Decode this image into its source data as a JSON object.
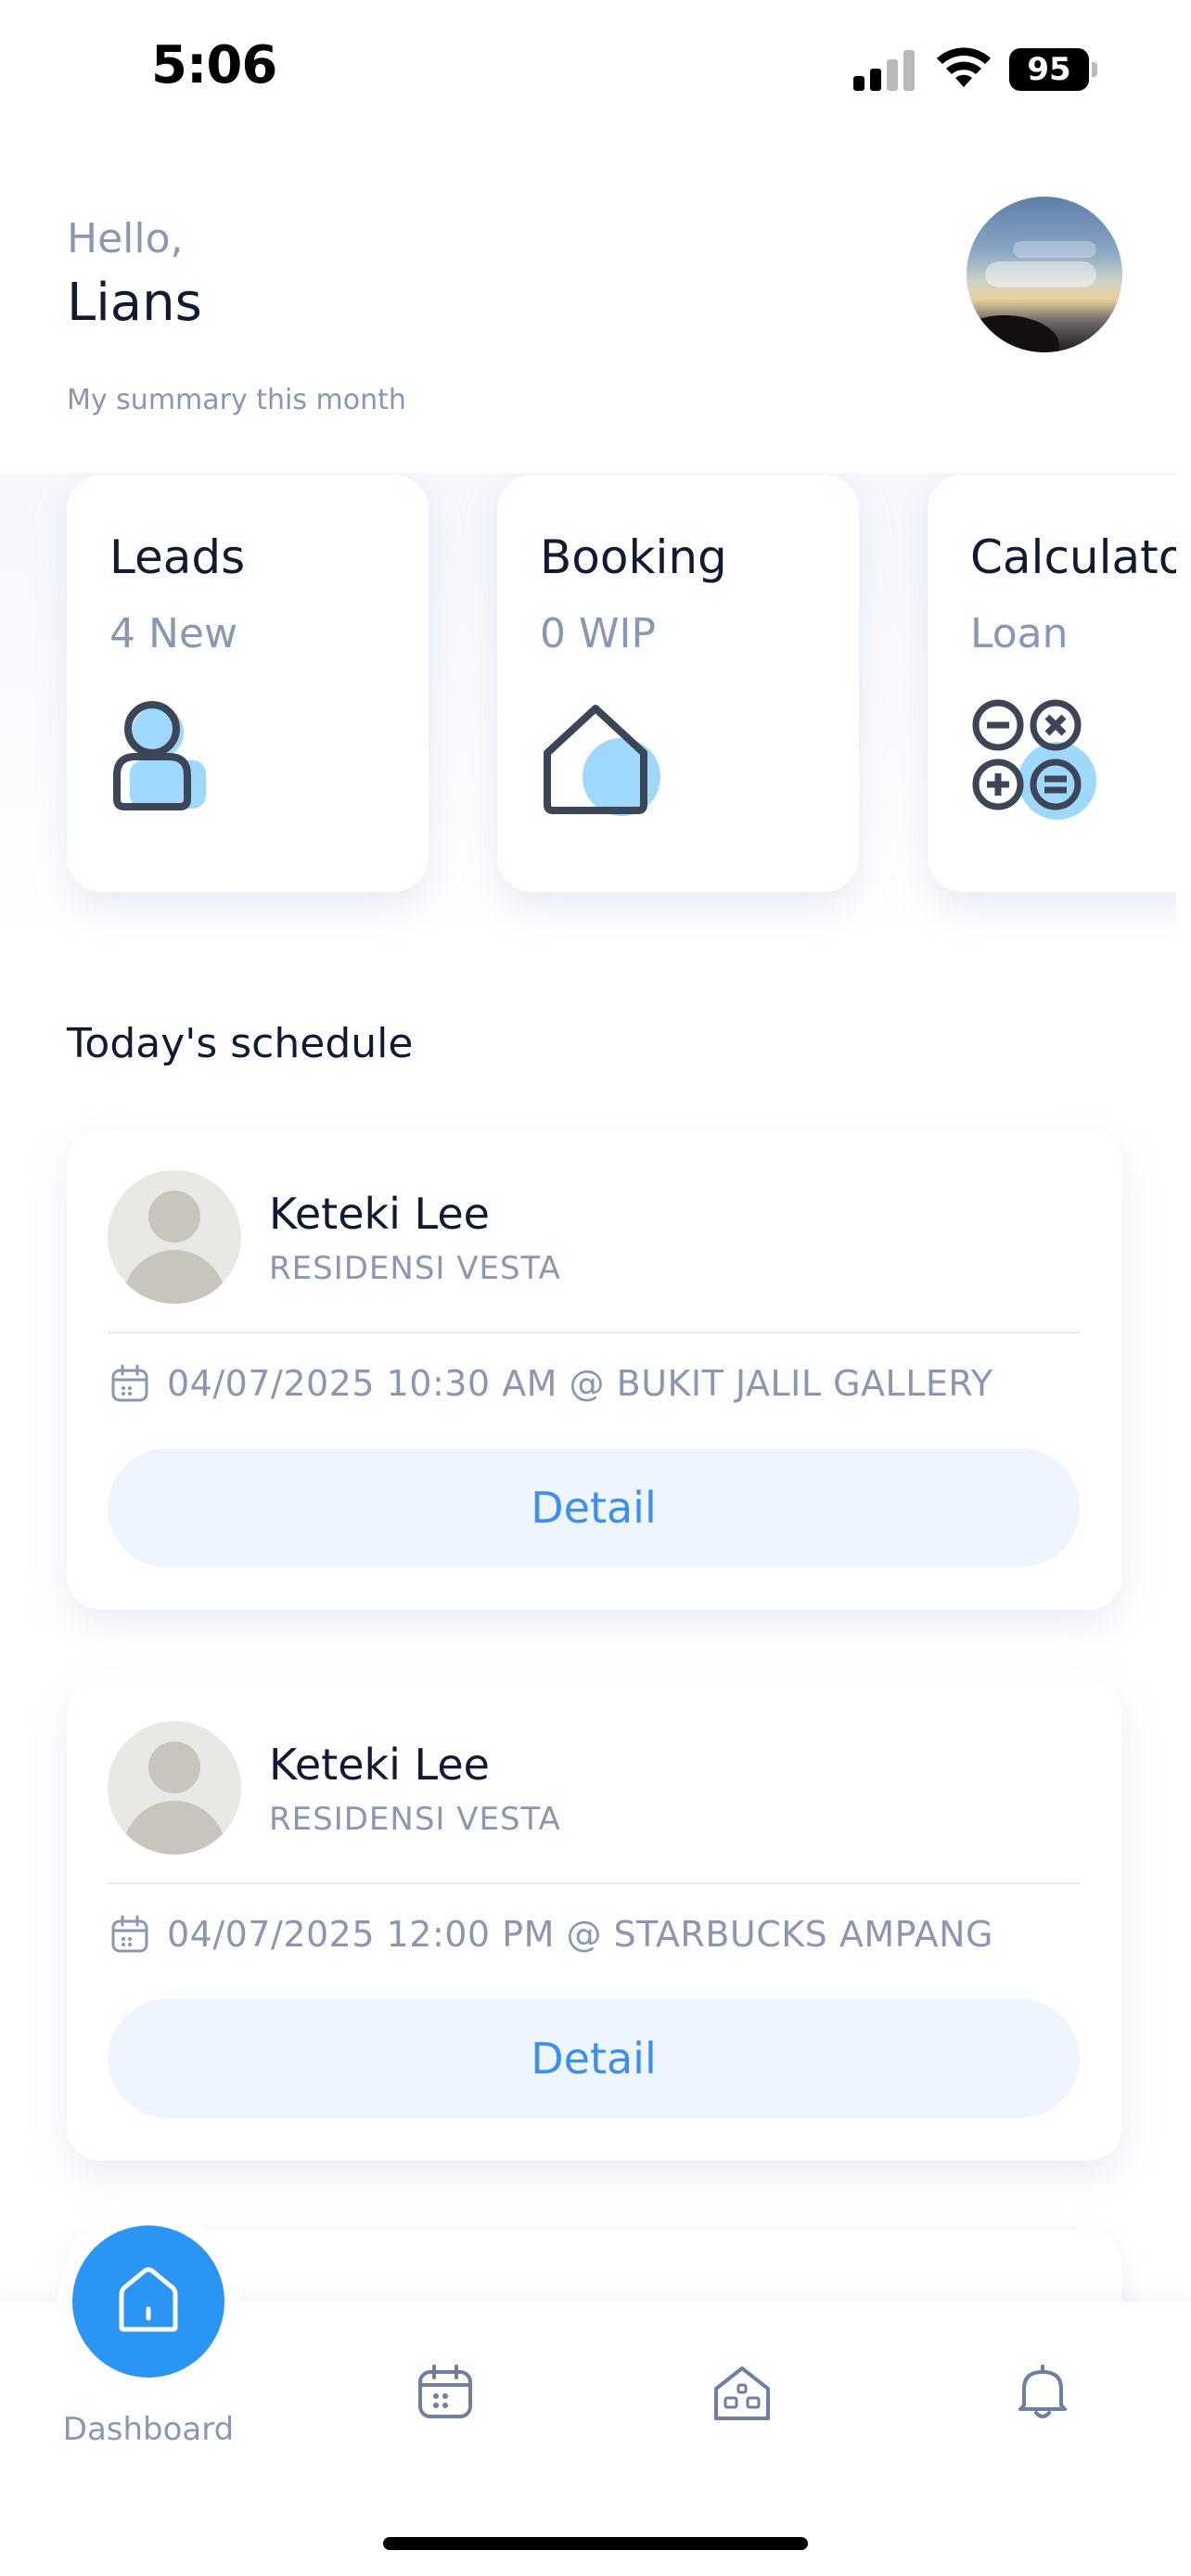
{
  "status_bar": {
    "time": "5:06",
    "battery": "95",
    "icons": [
      "signal-icon",
      "wifi-icon",
      "battery-icon"
    ]
  },
  "greeting": {
    "hello": "Hello,",
    "name": "Lians",
    "summary_label": "My summary this month"
  },
  "summary_cards": [
    {
      "title": "Leads",
      "subtitle": "4 New",
      "icon": "user-icon"
    },
    {
      "title": "Booking",
      "subtitle": "0 WIP",
      "icon": "house-icon"
    },
    {
      "title": "Calculator",
      "subtitle": "Loan",
      "icon": "calculator-icon"
    }
  ],
  "schedule": {
    "title": "Today's schedule",
    "items": [
      {
        "name": "Keteki Lee",
        "project": "RESIDENSI VESTA",
        "appointment": "04/07/2025 10:30 AM @ BUKIT JALIL GALLERY",
        "button_label": "Detail"
      },
      {
        "name": "Keteki Lee",
        "project": "RESIDENSI VESTA",
        "appointment": "04/07/2025 12:00 PM @ STARBUCKS AMPANG",
        "button_label": "Detail"
      }
    ]
  },
  "tab_bar": {
    "dashboard_label": "Dashboard",
    "tabs": [
      "home-icon",
      "calendar-icon",
      "building-icon",
      "bell-icon"
    ]
  },
  "colors": {
    "accent": "#2a95f2",
    "button_bg": "#eef5ff",
    "button_text": "#3a8ff0",
    "muted_text": "#8a97b3",
    "icon_highlight": "#9ed8fb",
    "icon_stroke": "#3c4656"
  }
}
